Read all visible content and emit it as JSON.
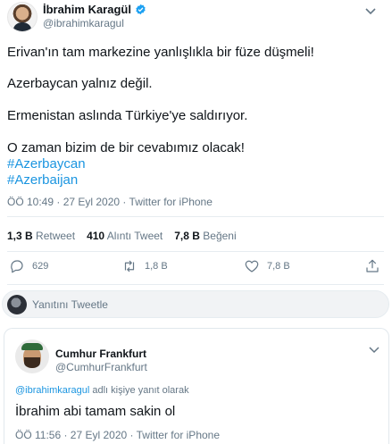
{
  "tweet": {
    "author": {
      "display_name": "İbrahim Karagül",
      "handle": "@ibrahimkaragul",
      "verified": true
    },
    "body": {
      "line1": "Erivan'ın tam markezine yanlışlıkla bir füze düşmeli!",
      "line2": "Azerbaycan yalnız değil.",
      "line3": "Ermenistan aslında Türkiye'ye saldırıyor.",
      "line4": "O zaman bizim de bir cevabımız olacak!",
      "hashtag1": "#Azerbaycan",
      "hashtag2": "#Azerbaijan"
    },
    "meta": "ÖÖ 10:49 · 27 Eyl 2020 · Twitter for iPhone",
    "stats": {
      "retweet_count": "1,3 B",
      "retweet_label": "Retweet",
      "quote_count": "410",
      "quote_label": "Alıntı Tweet",
      "like_count": "7,8 B",
      "like_label": "Beğeni"
    },
    "actions": {
      "reply_count": "629",
      "retweet_count": "1,8 B",
      "like_count": "7,8 B"
    }
  },
  "reply_composer": {
    "placeholder": "Yanıtını Tweetle"
  },
  "reply": {
    "author": {
      "display_name": "Cumhur Frankfurt",
      "handle": "@CumhurFrankfurt"
    },
    "replying_mention": "@ibrahimkaragul",
    "replying_suffix": " adlı kişiye yanıt olarak",
    "text": "İbrahim abi tamam sakin ol",
    "meta": "ÖÖ 11:56 · 27 Eyl 2020 · Twitter for iPhone"
  },
  "colors": {
    "accent": "#1b95e0",
    "muted": "#657786",
    "verified": "#1da1f2"
  },
  "icons": {
    "verified": "verified-badge-icon",
    "more": "chevron-down-icon",
    "reply": "comment-icon",
    "retweet": "retweet-icon",
    "like": "heart-icon",
    "share": "share-icon"
  }
}
